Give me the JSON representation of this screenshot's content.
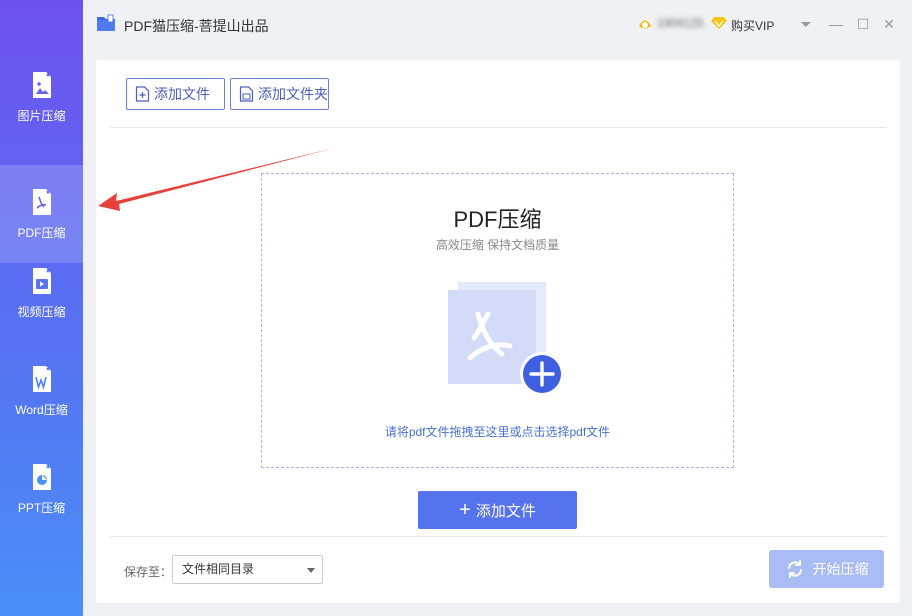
{
  "app": {
    "title": "PDF猫压缩-菩提山出品",
    "user_name": "1904125",
    "vip_label": "购买VIP"
  },
  "window": {
    "menu": "⏷",
    "minimize": "—",
    "maximize": "☐",
    "close": "✕"
  },
  "sidebar": {
    "items": [
      {
        "label": "图片压缩",
        "icon": "image-file-icon"
      },
      {
        "label": "PDF压缩",
        "icon": "pdf-file-icon",
        "active": true
      },
      {
        "label": "视频压缩",
        "icon": "video-file-icon"
      },
      {
        "label": "Word压缩",
        "icon": "word-file-icon"
      },
      {
        "label": "PPT压缩",
        "icon": "ppt-file-icon"
      }
    ]
  },
  "toolbar": {
    "add_file": "添加文件",
    "add_folder": "添加文件夹"
  },
  "dropzone": {
    "title": "PDF压缩",
    "subtitle": "高效压缩 保持文档质量",
    "hint": "请将pdf文件拖拽至这里或点击选择pdf文件"
  },
  "add_button": {
    "label": "添加文件"
  },
  "footer": {
    "save_label": "保存至：",
    "save_value": "文件相同目录",
    "start_label": "开始压缩"
  },
  "colors": {
    "accent": "#5573ec",
    "sidebar_top": "#6f52ee",
    "sidebar_bottom": "#4a8ef6",
    "start_disabled": "#a9bcf4",
    "annotation_arrow": "#e8403a"
  }
}
